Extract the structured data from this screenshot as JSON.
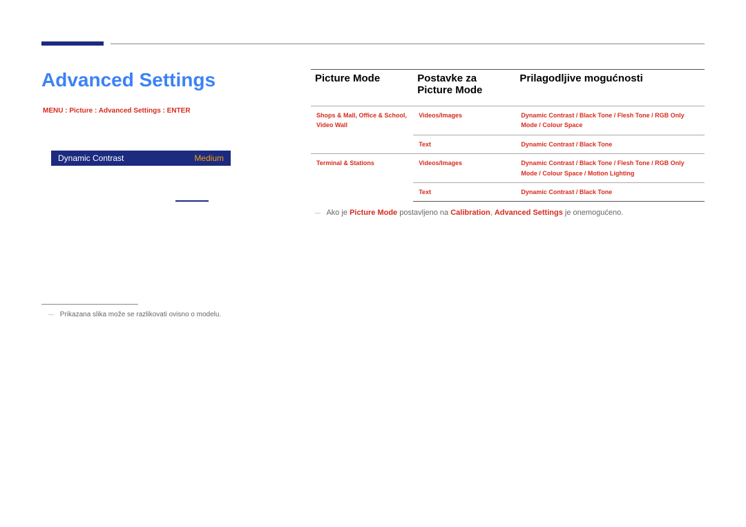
{
  "title": "Advanced Settings",
  "menu_path": "MENU : Picture : Advanced Settings : ENTER",
  "preview": {
    "label": "Dynamic Contrast",
    "value": "Medium"
  },
  "footnote": "Prikazana slika može se razlikovati ovisno o modelu.",
  "table": {
    "headers": {
      "col1": "Picture Mode",
      "col2": "Postavke za Picture Mode",
      "col3": "Prilagodljive mogućnosti"
    },
    "rows": [
      {
        "c1": "Shops & Mall, Office & School, Video Wall",
        "c2": "Videos/Images",
        "c3": "Dynamic Contrast / Black Tone / Flesh Tone / RGB Only Mode / Colour Space"
      },
      {
        "c1": "",
        "c2": "Text",
        "c3": "Dynamic Contrast / Black Tone"
      },
      {
        "c1": "Terminal & Stations",
        "c2": "Videos/Images",
        "c3": "Dynamic Contrast / Black Tone / Flesh Tone / RGB Only Mode / Colour Space / Motion Lighting"
      },
      {
        "c1": "",
        "c2": "Text",
        "c3": "Dynamic Contrast / Black Tone"
      }
    ]
  },
  "note": {
    "pre": "Ako je ",
    "hl1": "Picture Mode",
    "mid": " postavljeno na ",
    "hl2": "Calibration",
    "mid2": ", ",
    "hl3": "Advanced Settings",
    "post": " je onemogućeno."
  }
}
